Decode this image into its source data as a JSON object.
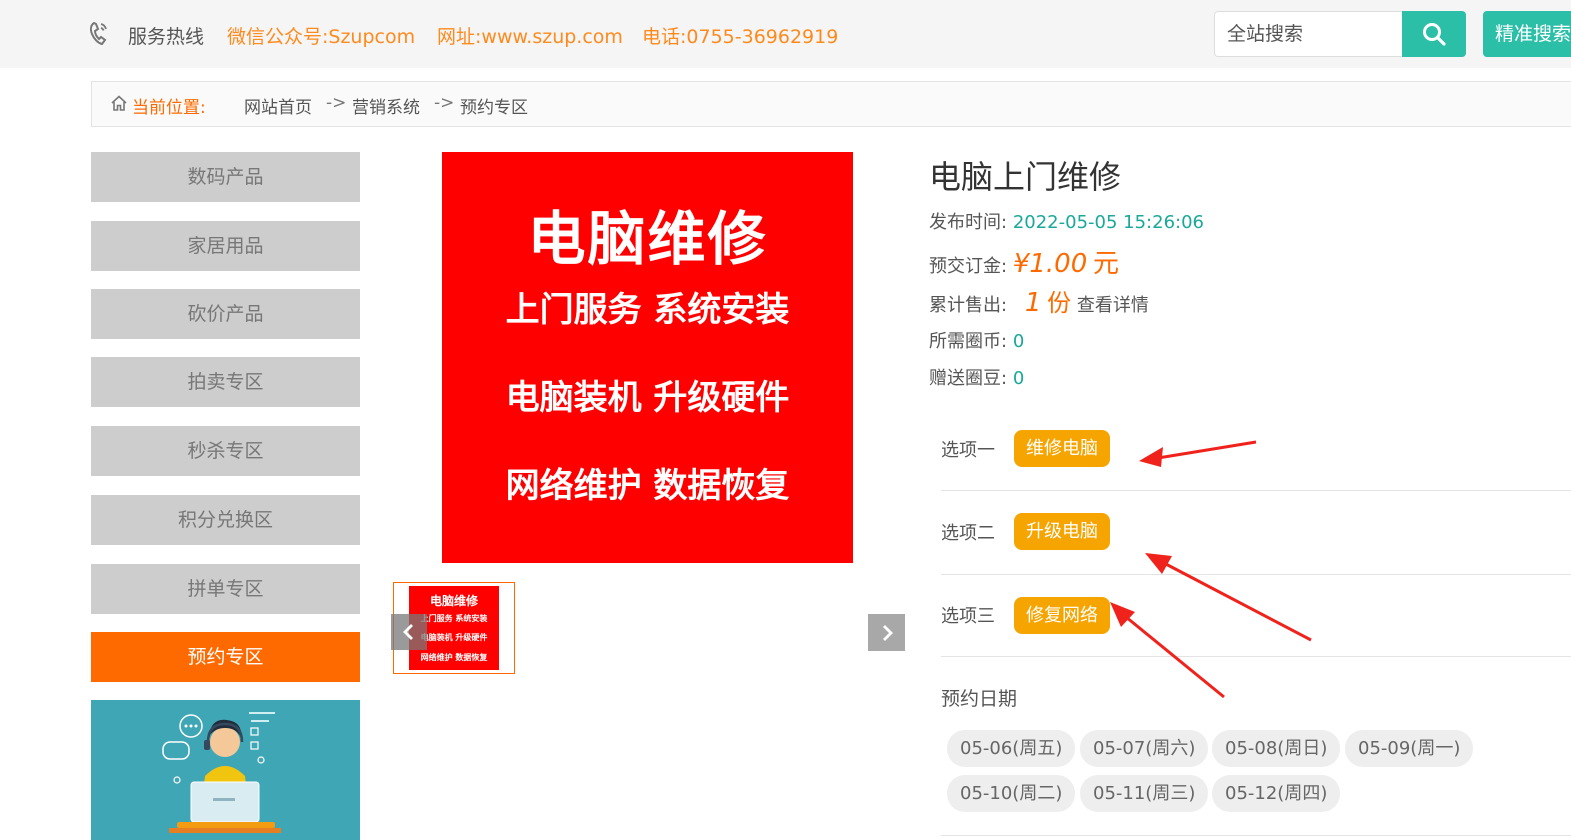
{
  "header": {
    "hotline": "服务热线",
    "wechat": "微信公众号:Szupcom",
    "website": "网址:www.szup.com",
    "phone": "电话:0755-36962919",
    "search_placeholder": "全站搜索",
    "precise_search": "精准搜索",
    "accent_color": "#2bbfa8",
    "contact_color": "#ff8a1c"
  },
  "breadcrumb": {
    "label": "当前位置:",
    "items": [
      "网站首页",
      "营销系统",
      "预约专区"
    ],
    "separator": "->"
  },
  "sidebar": {
    "items": [
      {
        "label": "数码产品",
        "active": false
      },
      {
        "label": "家居用品",
        "active": false
      },
      {
        "label": "砍价产品",
        "active": false
      },
      {
        "label": "拍卖专区",
        "active": false
      },
      {
        "label": "秒杀专区",
        "active": false
      },
      {
        "label": "积分兑换区",
        "active": false
      },
      {
        "label": "拼单专区",
        "active": false
      },
      {
        "label": "预约专区",
        "active": true
      }
    ],
    "active_color": "#ff6a00"
  },
  "product_image": {
    "title": "电脑维修",
    "lines": [
      "上门服务  系统安装",
      "电脑装机  升级硬件",
      "网络维护  数据恢复"
    ],
    "thumb_title": "电脑维修",
    "thumb_lines": [
      "上门服务 系统安装",
      "电脑装机 升级硬件",
      "网络维护 数据恢复"
    ]
  },
  "product": {
    "title": "电脑上门维修",
    "publish_label": "发布时间:",
    "publish_time": "2022-05-05 15:26:06",
    "deposit_label": "预交订金:",
    "deposit_value": "¥1.00",
    "deposit_unit": "元",
    "sold_label": "累计售出:",
    "sold_value": "1",
    "sold_unit": "份",
    "detail_link": "查看详情",
    "coin_label": "所需圈币:",
    "coin_value": "0",
    "bean_label": "赠送圈豆:",
    "bean_value": "0"
  },
  "options": [
    {
      "label": "选项一",
      "value": "维修电脑"
    },
    {
      "label": "选项二",
      "value": "升级电脑"
    },
    {
      "label": "选项三",
      "value": "修复网络"
    }
  ],
  "booking": {
    "title": "预约日期",
    "dates": [
      "05-06(周五)",
      "05-07(周六)",
      "05-08(周日)",
      "05-09(周一)",
      "05-10(周二)",
      "05-11(周三)",
      "05-12(周四)"
    ]
  }
}
